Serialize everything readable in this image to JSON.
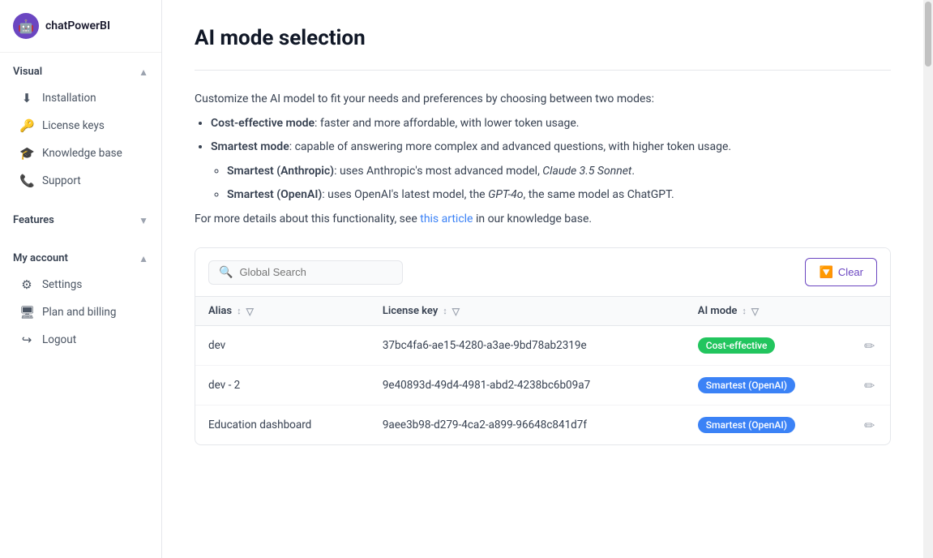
{
  "app": {
    "name": "chatPowerBI"
  },
  "sidebar": {
    "visual_section": {
      "label": "Visual",
      "expanded": true,
      "items": [
        {
          "id": "installation",
          "label": "Installation",
          "icon": "⬇"
        },
        {
          "id": "license-keys",
          "label": "License keys",
          "icon": "🔑"
        },
        {
          "id": "knowledge-base",
          "label": "Knowledge base",
          "icon": "🎓"
        },
        {
          "id": "support",
          "label": "Support",
          "icon": "📞"
        }
      ]
    },
    "features_section": {
      "label": "Features",
      "expanded": false,
      "items": []
    },
    "myaccount_section": {
      "label": "My account",
      "expanded": true,
      "items": [
        {
          "id": "settings",
          "label": "Settings",
          "icon": "⚙"
        },
        {
          "id": "plan-billing",
          "label": "Plan and billing",
          "icon": "🖥"
        },
        {
          "id": "logout",
          "label": "Logout",
          "icon": "→"
        }
      ]
    }
  },
  "page": {
    "title": "AI mode selection",
    "description_intro": "Customize the AI model to fit your needs and preferences by choosing between two modes:",
    "bullet1_bold": "Cost-effective mode",
    "bullet1_rest": ": faster and more affordable, with lower token usage.",
    "bullet2_bold": "Smartest mode",
    "bullet2_rest": ": capable of answering more complex and advanced questions, with higher token usage.",
    "sub_bullet1_bold": "Smartest (Anthropic)",
    "sub_bullet1_rest": ": uses Anthropic's most advanced model, ",
    "sub_bullet1_italic": "Claude 3.5 Sonnet",
    "sub_bullet1_end": ".",
    "sub_bullet2_bold": "Smartest (OpenAI)",
    "sub_bullet2_rest": ": uses OpenAI's latest model, the ",
    "sub_bullet2_italic": "GPT-4o",
    "sub_bullet2_end": ", the same model as ChatGPT.",
    "footer_text_before": "For more details about this functionality, see ",
    "footer_link": "this article",
    "footer_text_after": " in our knowledge base."
  },
  "toolbar": {
    "search_placeholder": "Global Search",
    "clear_label": "Clear"
  },
  "table": {
    "columns": [
      {
        "id": "alias",
        "label": "Alias",
        "sortable": true,
        "filterable": true
      },
      {
        "id": "license_key",
        "label": "License key",
        "sortable": true,
        "filterable": true
      },
      {
        "id": "ai_mode",
        "label": "AI mode",
        "sortable": true,
        "filterable": true
      }
    ],
    "rows": [
      {
        "alias": "dev",
        "license_key": "37bc4fa6-ae15-4280-a3ae-9bd78ab2319e",
        "ai_mode": "Cost-effective",
        "badge_type": "green"
      },
      {
        "alias": "dev - 2",
        "license_key": "9e40893d-49d4-4981-abd2-4238bc6b09a7",
        "ai_mode": "Smartest (OpenAI)",
        "badge_type": "blue"
      },
      {
        "alias": "Education dashboard",
        "license_key": "9aee3b98-d279-4ca2-a899-96648c841d7f",
        "ai_mode": "Smartest (OpenAI)",
        "badge_type": "blue"
      }
    ]
  }
}
